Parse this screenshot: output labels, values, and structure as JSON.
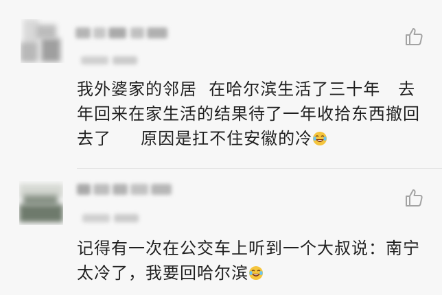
{
  "comments": [
    {
      "lines": [
        "我外婆家的邻居  在哈尔滨生活了三十年   去",
        "年回来在家生活的结果待了一年收拾东西撤回",
        "去了     原因是扛不住安徽的冷"
      ],
      "emoji": "laughing-crying-emoji",
      "avatar_blurred": true,
      "name_blurred": true,
      "time_blurred": true,
      "like_icon": "thumbs-up-icon"
    },
    {
      "lines": [
        "记得有一次在公交车上听到一个大叔说：南宁",
        "太冷了，我要回哈尔滨"
      ],
      "emoji": "laughing-crying-emoji",
      "avatar_blurred": true,
      "name_blurred": true,
      "time_blurred": true,
      "like_icon": "thumbs-up-icon"
    }
  ],
  "colors": {
    "background": "#f7f7f7",
    "text": "#1f1f1f",
    "icon": "#a3a3a3",
    "divider": "#e4e4e4"
  }
}
